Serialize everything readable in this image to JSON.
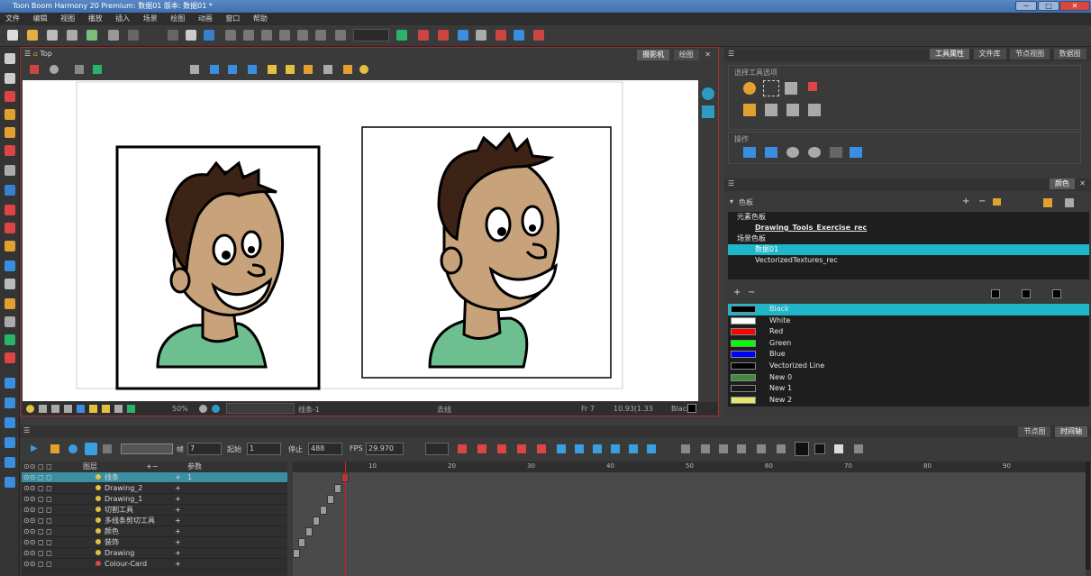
{
  "window": {
    "title": "Toon Boom Harmony 20 Premium: 数据01 版本: 数据01 *"
  },
  "menu": [
    "文件",
    "编辑",
    "视图",
    "播放",
    "插入",
    "场景",
    "绘图",
    "动画",
    "窗口",
    "帮助"
  ],
  "camera": {
    "view_label": "Top",
    "tabs": [
      "摄影机",
      "绘图"
    ],
    "status": {
      "zoom": "50%",
      "layer": "线条-1",
      "mode": "去线",
      "frame": "Fr 7",
      "coords": "10.93(1.33",
      "color": "Black"
    }
  },
  "right_panel": {
    "top_tabs": [
      "工具属性",
      "文件库",
      "节点视图",
      "数据图"
    ],
    "tool_group_label": "选择工具选项",
    "operation_label": "操作",
    "color_tab": "颜色",
    "palette_section": "色板",
    "palette_list": [
      {
        "label": "元素色板",
        "indent": false
      },
      {
        "label": "Drawing_Tools_Exercise_rec",
        "indent": true
      },
      {
        "label": "场景色板",
        "indent": false
      },
      {
        "label": "数据01",
        "indent": true,
        "selected": true
      },
      {
        "label": "VectorizedTextures_rec",
        "indent": true
      }
    ],
    "swatches": [
      {
        "name": "Black",
        "color": "#000000",
        "selected": true
      },
      {
        "name": "White",
        "color": "#ffffff"
      },
      {
        "name": "Red",
        "color": "#ff0000"
      },
      {
        "name": "Green",
        "color": "#00ff00"
      },
      {
        "name": "Blue",
        "color": "#0000ff"
      },
      {
        "name": "Vectorized Line",
        "color": "#000000"
      },
      {
        "name": "New 0",
        "color": "#3f8a3f"
      },
      {
        "name": "New 1",
        "color": "#1a1a1a"
      },
      {
        "name": "New 2",
        "color": "#e6e66a"
      }
    ]
  },
  "timeline": {
    "tabs": [
      "节点图",
      "时间轴"
    ],
    "frame_label": "帧",
    "frame_value": "7",
    "start_label": "起始",
    "start_value": "1",
    "stop_label": "停止",
    "stop_value": "488",
    "fps_label": "FPS",
    "fps_value": "29.970",
    "layer_header": "图层",
    "param_header": "参数",
    "param_value": "1",
    "layers": [
      {
        "name": "线条",
        "selected": true
      },
      {
        "name": "Drawing_2"
      },
      {
        "name": "Drawing_1"
      },
      {
        "name": "切割工具"
      },
      {
        "name": "多线条剪切工具"
      },
      {
        "name": "颜色"
      },
      {
        "name": "装饰"
      },
      {
        "name": "Drawing"
      },
      {
        "name": "Colour-Card"
      }
    ],
    "ruler_marks": [
      "10",
      "20",
      "30",
      "40",
      "50",
      "60",
      "70",
      "80",
      "90"
    ]
  }
}
